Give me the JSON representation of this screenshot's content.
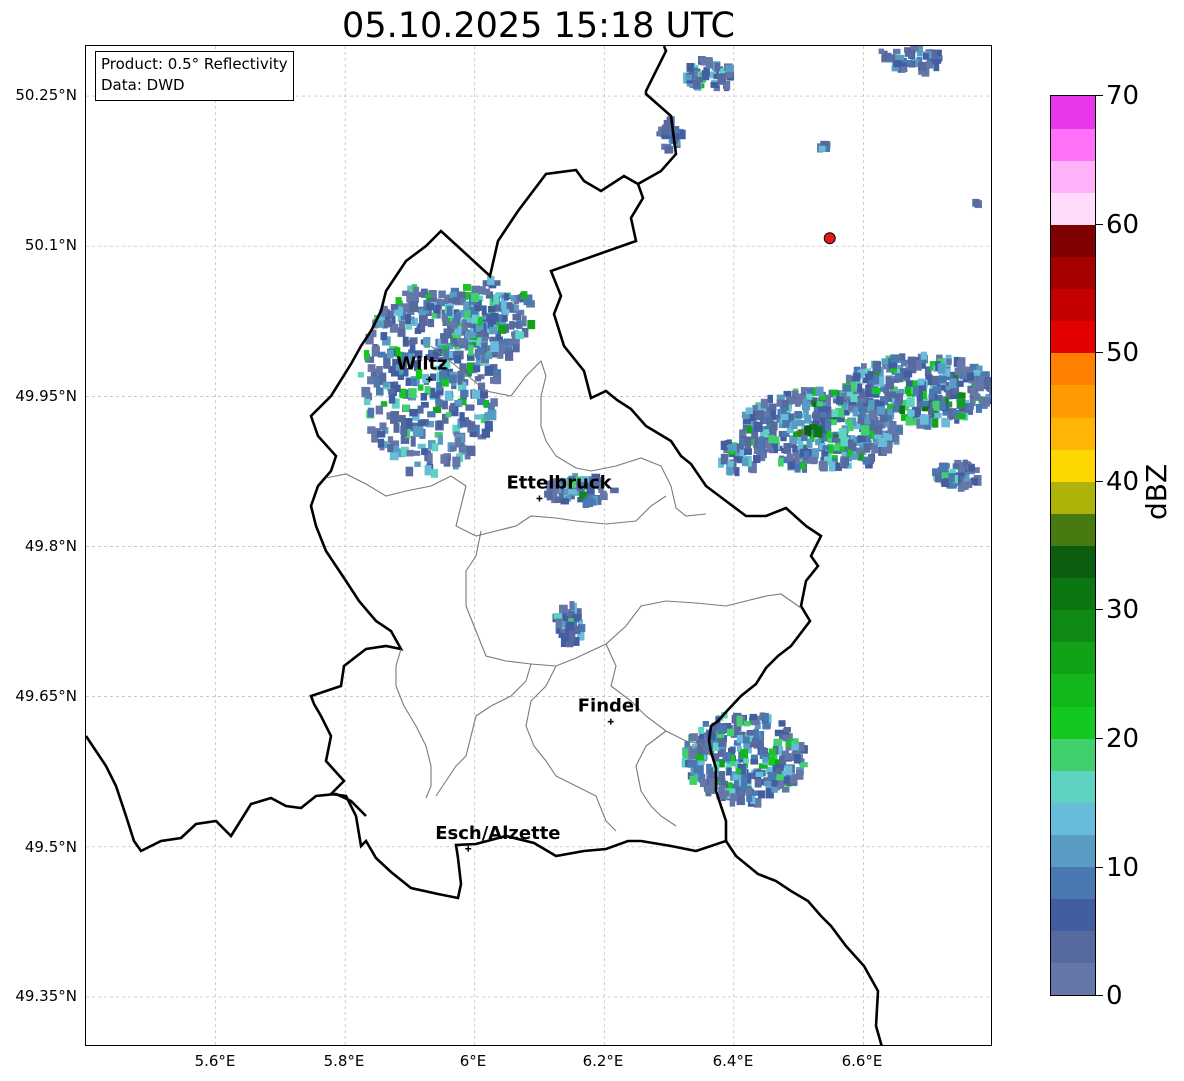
{
  "title": "05.10.2025 15:18 UTC",
  "info_box": {
    "product": "Product: 0.5° Reflectivity",
    "source": "Data: DWD"
  },
  "axes": {
    "lat_ticks": [
      "50.25°N",
      "50.1°N",
      "49.95°N",
      "49.8°N",
      "49.65°N",
      "49.5°N",
      "49.35°N"
    ],
    "lon_ticks": [
      "5.6°E",
      "5.8°E",
      "6°E",
      "6.2°E",
      "6.4°E",
      "6.6°E"
    ],
    "lat_range": [
      49.3,
      50.3
    ],
    "lon_range": [
      5.4,
      6.8
    ],
    "gridlines": true
  },
  "cities": [
    {
      "name": "Wiltz",
      "lon": 5.93,
      "lat": 49.967
    },
    {
      "name": "Ettelbruck",
      "lon": 6.1,
      "lat": 49.848
    },
    {
      "name": "Findel",
      "lon": 6.21,
      "lat": 49.625
    },
    {
      "name": "Esch/Alzette",
      "lon": 5.99,
      "lat": 49.498
    }
  ],
  "radar_site_marker": {
    "lon": 6.548,
    "lat": 50.108,
    "color": "#e31a1c"
  },
  "colorbar": {
    "label": "dBZ",
    "min": 0,
    "max": 70,
    "step": 2.5,
    "tick_labels": [
      "0",
      "10",
      "20",
      "30",
      "40",
      "50",
      "60",
      "70"
    ],
    "colors": [
      "#6577a8",
      "#566a9f",
      "#435ea0",
      "#4a78b0",
      "#589cc4",
      "#67bcda",
      "#5fd3c2",
      "#40d06c",
      "#13c81f",
      "#12b81b",
      "#12a217",
      "#0f8a15",
      "#0c7612",
      "#0b5e10",
      "#477a10",
      "#aeb30a",
      "#ffd700",
      "#ffb505",
      "#ff9a00",
      "#ff7f00",
      "#e20000",
      "#c50000",
      "#a70000",
      "#7e0000",
      "#ffdcf9",
      "#ffb2f9",
      "#ff72f8",
      "#ea36ea"
    ]
  }
}
